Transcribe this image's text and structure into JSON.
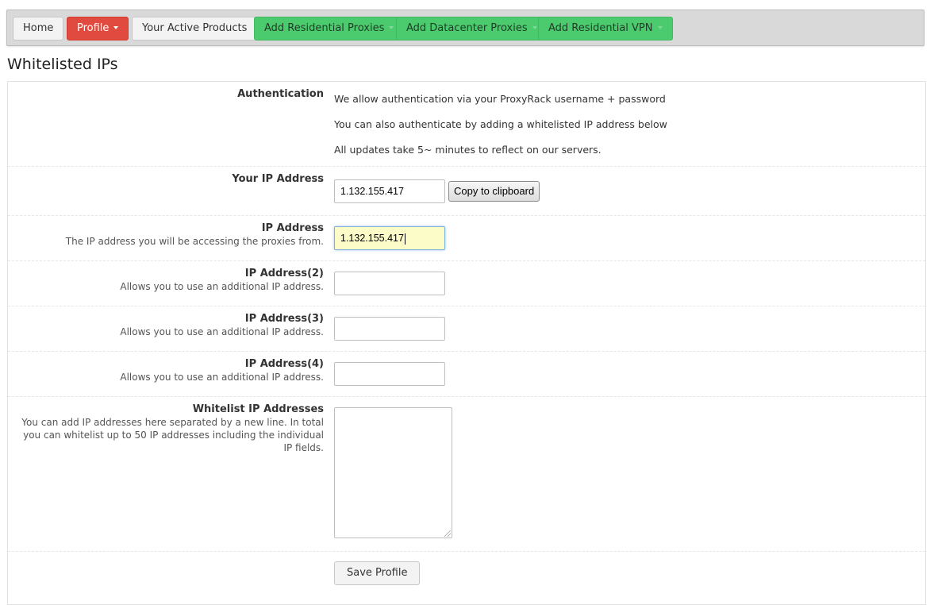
{
  "nav": {
    "home": "Home",
    "profile": "Profile",
    "active_products": "Your Active Products",
    "add_residential_proxies": "Add Residential Proxies",
    "add_datacenter_proxies": "Add Datacenter Proxies",
    "add_residential_vpn": "Add Residential VPN"
  },
  "page": {
    "title": "Whitelisted IPs"
  },
  "auth": {
    "label": "Authentication",
    "lines": [
      "We allow authentication via your ProxyRack username + password",
      "You can also authenticate by adding a whitelisted IP address below",
      "All updates take 5~ minutes to reflect on our servers."
    ]
  },
  "your_ip": {
    "label": "Your IP Address",
    "value": "1.132.155.417",
    "copy_button": "Copy to clipboard"
  },
  "ip1": {
    "label": "IP Address",
    "hint": "The IP address you will be accessing the proxies from.",
    "value": "1.132.155.417"
  },
  "ip2": {
    "label": "IP Address(2)",
    "hint": "Allows you to use an additional IP address.",
    "value": ""
  },
  "ip3": {
    "label": "IP Address(3)",
    "hint": "Allows you to use an additional IP address.",
    "value": ""
  },
  "ip4": {
    "label": "IP Address(4)",
    "hint": "Allows you to use an additional IP address.",
    "value": ""
  },
  "whitelist": {
    "label": "Whitelist IP Addresses",
    "hint": "You can add IP addresses here separated by a new line. In total you can whitelist up to 50 IP addresses including the individual IP fields.",
    "value": ""
  },
  "save_button": "Save Profile",
  "colors": {
    "profile_red": "#e14b3f",
    "add_green": "#4ccb6e",
    "highlight_input": "#fcfcc8"
  },
  "icons": {
    "dropdown": "caret-down-icon"
  }
}
